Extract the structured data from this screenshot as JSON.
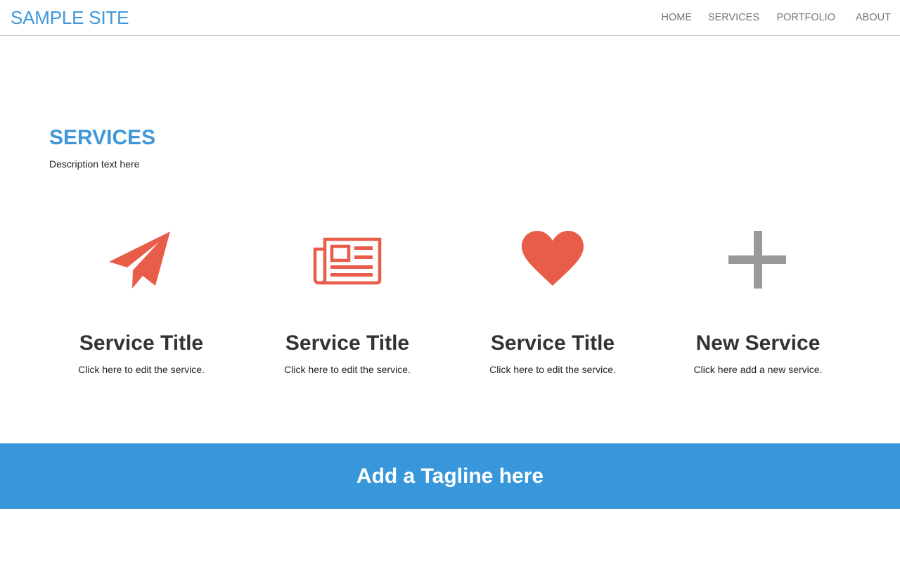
{
  "header": {
    "brand": "SAMPLE SITE",
    "nav": [
      "HOME",
      "SERVICES",
      "PORTFOLIO",
      "ABOUT"
    ]
  },
  "section": {
    "heading": "SERVICES",
    "description": "Description text here"
  },
  "services": [
    {
      "icon": "paper-plane-icon",
      "title": "Service Title",
      "desc": "Click here to edit the service."
    },
    {
      "icon": "newspaper-icon",
      "title": "Service Title",
      "desc": "Click here to edit the service."
    },
    {
      "icon": "heart-icon",
      "title": "Service Title",
      "desc": "Click here to edit the service."
    },
    {
      "icon": "plus-icon",
      "title": "New Service",
      "desc": "Click here add a new service."
    }
  ],
  "tagline": "Add a Tagline here",
  "colors": {
    "brand_blue": "#3f97d9",
    "accent_red": "#e85d4a",
    "plus_gray": "#999999",
    "band_blue": "#3897db"
  }
}
